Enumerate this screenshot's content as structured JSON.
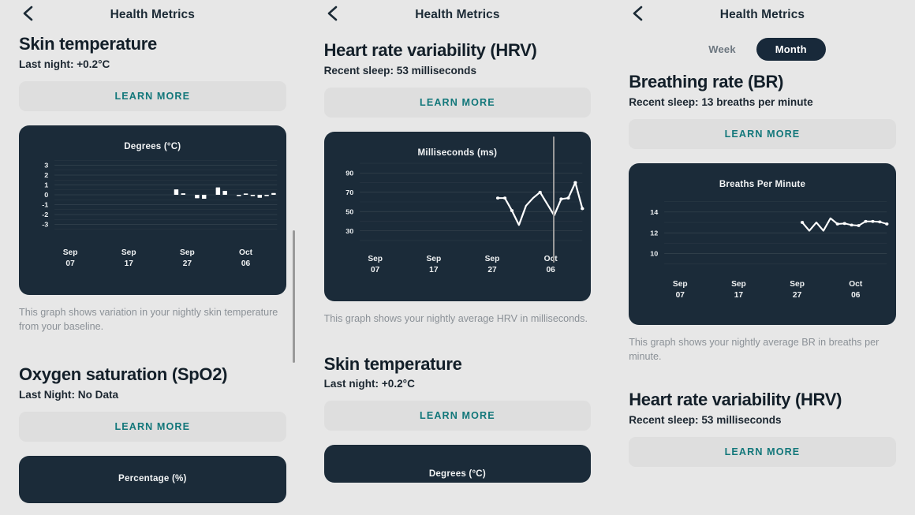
{
  "app": {
    "header_title": "Health Metrics",
    "back_icon": "chevron-left-icon",
    "learn_more_label": "LEARN MORE",
    "accent_color": "#12777a",
    "card_color": "#1b2b39",
    "background_color": "#e7e7e7"
  },
  "toggle": {
    "week_label": "Week",
    "month_label": "Month",
    "selected": "Month"
  },
  "panel1": {
    "section1": {
      "title": "Skin temperature",
      "subtitle": "Last night: +0.2°C",
      "caption": "This graph shows variation in your nightly skin temperature from your baseline."
    },
    "section2": {
      "title": "Oxygen saturation (SpO2)",
      "subtitle": "Last Night: No Data"
    },
    "partial_chart_title": "Percentage (%)"
  },
  "panel2": {
    "section1": {
      "title": "Heart rate variability (HRV)",
      "subtitle": "Recent sleep: 53 milliseconds",
      "caption": "This graph shows your nightly average HRV in milliseconds."
    },
    "section2": {
      "title": "Skin temperature",
      "subtitle": "Last night: +0.2°C"
    },
    "partial_chart_title": "Degrees (°C)"
  },
  "panel3": {
    "section1": {
      "title": "Breathing rate (BR)",
      "subtitle": "Recent sleep: 13 breaths per minute",
      "caption": "This graph shows your nightly average BR in breaths per minute."
    },
    "section2": {
      "title": "Heart rate variability (HRV)",
      "subtitle": "Recent sleep: 53 milliseconds"
    }
  },
  "chart_data": [
    {
      "id": "skin-temperature-chart",
      "type": "bar",
      "title": "Degrees (°C)",
      "xlabel": "",
      "ylabel": "Degrees (°C)",
      "ylim": [
        -3.6,
        3.6
      ],
      "yticks": [
        3,
        2,
        1,
        0,
        -1,
        -2,
        -3
      ],
      "grid": true,
      "xtick_labels": [
        {
          "month": "Sep",
          "day": "07"
        },
        {
          "month": "Sep",
          "day": "17"
        },
        {
          "month": "Sep",
          "day": "27"
        },
        {
          "month": "Oct",
          "day": "06"
        }
      ],
      "x": [
        17,
        18,
        20,
        21,
        23,
        24,
        26,
        27,
        28,
        29,
        30,
        31
      ],
      "values": [
        0.55,
        0.15,
        -0.35,
        -0.4,
        0.75,
        0.4,
        -0.08,
        0.12,
        -0.1,
        -0.3,
        -0.08,
        0.18
      ],
      "bar_color": "#ffffff"
    },
    {
      "id": "hrv-chart",
      "type": "line",
      "title": "Milliseconds (ms)",
      "xlabel": "",
      "ylabel": "Milliseconds (ms)",
      "ylim": [
        24,
        96
      ],
      "yticks": [
        90,
        70,
        50,
        30
      ],
      "grid": true,
      "xtick_labels": [
        {
          "month": "Sep",
          "day": "07"
        },
        {
          "month": "Sep",
          "day": "17"
        },
        {
          "month": "Sep",
          "day": "27"
        },
        {
          "month": "Oct",
          "day": "06"
        }
      ],
      "x": [
        20,
        21,
        22,
        23,
        24,
        25,
        26,
        27,
        28,
        29,
        30,
        31
      ],
      "values": [
        64,
        64,
        51,
        36,
        56,
        64,
        70,
        58,
        46,
        63,
        64,
        80,
        53
      ],
      "line_color": "#ffffff"
    },
    {
      "id": "breathing-rate-chart",
      "type": "line",
      "title": "Breaths Per Minute",
      "xlabel": "",
      "ylabel": "Breaths Per Minute",
      "ylim": [
        9.1,
        15.3
      ],
      "yticks": [
        14,
        12,
        10
      ],
      "grid": true,
      "xtick_labels": [
        {
          "month": "Sep",
          "day": "07"
        },
        {
          "month": "Sep",
          "day": "17"
        },
        {
          "month": "Sep",
          "day": "27"
        },
        {
          "month": "Oct",
          "day": "06"
        }
      ],
      "x": [
        20,
        21,
        22,
        23,
        24,
        25,
        26,
        27,
        28,
        29,
        30,
        31
      ],
      "values": [
        13.0,
        12.2,
        13.0,
        12.2,
        13.4,
        12.85,
        12.9,
        12.75,
        12.7,
        13.1,
        13.1,
        13.05,
        12.85
      ],
      "line_color": "#ffffff"
    }
  ]
}
